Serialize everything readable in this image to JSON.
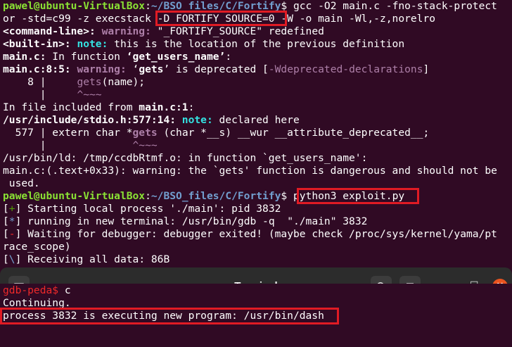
{
  "top_terminal": {
    "lines": [
      {
        "user": "pawel@ubuntu-VirtualBox",
        "path": "~/BSO_files/C/Fortify",
        "cmd": " gcc -O2 main.c -fno-stack-protect"
      },
      {
        "text_a": "or -std=c99 -z execstack ",
        "boxed": "-D_FORTIFY_SOURCE=0",
        "text_b": " -W -o main -Wl,-z,norelro"
      },
      {
        "bold": "<command-line>:",
        "warn": " warning:",
        "text": " \"_FORTIFY_SOURCE\" redefined"
      },
      {
        "bold": "<built-in>:",
        "note": " note:",
        "text": " this is the location of the previous definition"
      },
      {
        "bold": "main.c:",
        "text": " In function ",
        "bold2": "‘get_users_name’",
        "text2": ":"
      },
      {
        "bold": "main.c:8:5:",
        "warn": " warning:",
        "text": " ‘",
        "bold2": "gets",
        "text2": "’ is deprecated [",
        "mag": "-Wdeprecated-declarations",
        "text3": "]"
      },
      {
        "prefix": "    8 |     ",
        "mag": "gets",
        "text": "(name);"
      },
      {
        "prefix": "      |     ",
        "mag": "^~~~"
      },
      {
        "text": "In file included from ",
        "bold": "main.c:1",
        "text2": ":"
      },
      {
        "bold": "/usr/include/stdio.h:577:14:",
        "note": " note:",
        "text": " declared here"
      },
      {
        "prefix": "  577 | extern char *",
        "mag": "gets",
        "text": " (char *__s) __wur __attribute_deprecated__;"
      },
      {
        "prefix": "      |              ",
        "mag": "^~~~"
      },
      {
        "text": "/usr/bin/ld: /tmp/ccdbRtmf.o: in function `get_users_name':"
      },
      {
        "text": "main.c:(.text+0x33): warning: the `gets' function is dangerous and should not be"
      },
      {
        "text": " used."
      },
      {
        "user": "pawel@ubuntu-VirtualBox",
        "path": "~/BSO_files/C/Fortify",
        "boxed": "python3 exploit.py"
      },
      {
        "bracket": "+",
        "text": " Starting local process './main': pid 3832"
      },
      {
        "bracket": "*",
        "text": " running in new terminal: /usr/bin/gdb -q  \"./main\" 3832"
      },
      {
        "bracket": "-",
        "text": " Waiting for debugger: debugger exited! (maybe check /proc/sys/kernel/yama/pt"
      },
      {
        "text": "race_scope)"
      },
      {
        "bracket": "\\",
        "text": " Receiving all data: 86B"
      }
    ]
  },
  "window": {
    "title": "Terminal",
    "new_tab_icon": "new-tab-icon",
    "search_icon": "search-icon",
    "menu_icon": "hamburger-menu-icon",
    "minimize_glyph": "‒",
    "maximize_glyph": "□",
    "close_glyph": "✕"
  },
  "bottom_terminal": {
    "prompt": "gdb-peda$",
    "command": " c",
    "line2": "Continuing.",
    "line3": "process 3832 is executing new program: /usr/bin/dash"
  },
  "colors": {
    "background": "#300a24",
    "prompt_user": "#8ae234",
    "prompt_path": "#729fcf",
    "highlight_box": "#e01b24",
    "titlebar": "#2c2c2c"
  }
}
